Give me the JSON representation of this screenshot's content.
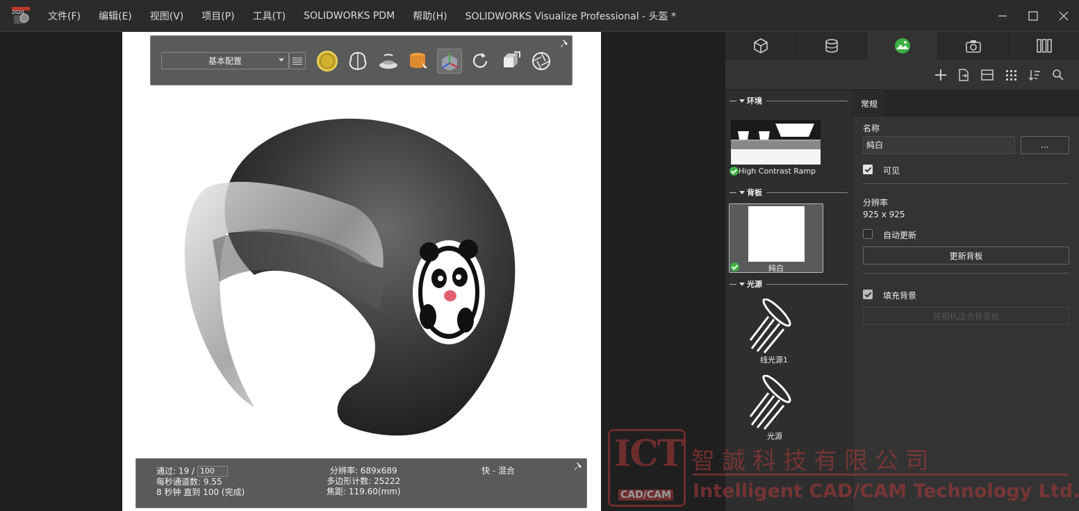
{
  "titlebar": {
    "logo_year": "2020",
    "menu": [
      "文件(F)",
      "编辑(E)",
      "视图(V)",
      "项目(P)",
      "工具(T)",
      "SOLIDWORKS PDM",
      "帮助(H)"
    ],
    "title": "SOLIDWORKS Visualize Professional - 头盔 *"
  },
  "toolbar": {
    "config_select": "基本配置"
  },
  "status": {
    "passes_label": "通过: 19 /",
    "passes_target": "100",
    "passes_per_sec": "每秒通道数: 9.55",
    "time_left": "8 秒钟 直到 100 (完成)",
    "resolution": "分辨率: 689x689",
    "polygons": "多边形计数: 25222",
    "focal": "焦距: 119.60(mm)",
    "mode": "快 - 混合"
  },
  "library": {
    "environment_header": "环境",
    "environment_item": "High Contrast Ramp",
    "backplate_header": "背板",
    "backplate_item": "純白",
    "lights_header": "光源",
    "light_1": "线光源1",
    "light_2": "光源"
  },
  "properties": {
    "tab": "常规",
    "name_label": "名称",
    "name_value": "純白",
    "browse": "...",
    "visible_label": "可见",
    "resolution_label": "分辨率",
    "resolution_value": "925 x 925",
    "auto_update_label": "自动更新",
    "update_button": "更新背板",
    "fill_bg_label": "填充背景",
    "disabled_button": "将相机适合背景板"
  },
  "watermark": {
    "logo": "ICT",
    "logo_sub": "CAD/CAM",
    "cn": "智誠科技有限公司",
    "en": "Intelligent CAD/CAM Technology Ltd."
  },
  "colors": {
    "accent_green": "#3cb043",
    "panel": "#333333",
    "toolbar": "#5a5a5a",
    "watermark_red": "#b03a3a"
  }
}
